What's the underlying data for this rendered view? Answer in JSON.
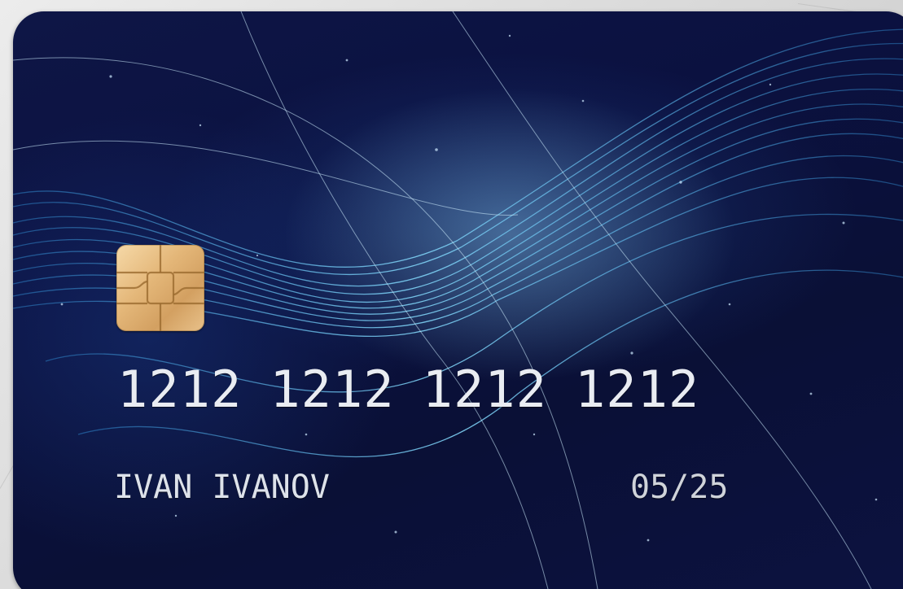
{
  "card": {
    "number_groups": [
      "1212",
      "1212",
      "1212",
      "1212"
    ],
    "holder_name": "IVAN IVANOV",
    "expiry": "05/25"
  },
  "colors": {
    "card_background": "#0b1140",
    "wave_accent": "#4fb6e6",
    "chip_gold": "#e4b779",
    "text": "#e9ecf2"
  }
}
